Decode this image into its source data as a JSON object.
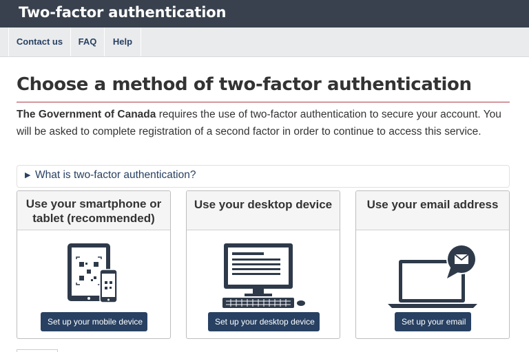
{
  "header": {
    "title": "Two-factor authentication"
  },
  "nav": {
    "items": [
      "Contact us",
      "FAQ",
      "Help"
    ]
  },
  "main": {
    "heading": "Choose a method of two-factor authentication",
    "intro_strong": "The Government of Canada",
    "intro_text": " requires the use of two-factor authentication to secure your account. You will be asked to complete registration of a second factor in order to continue to access this service.",
    "details_summary": "What is two-factor authentication?"
  },
  "cards": [
    {
      "title": "Use your smartphone or tablet (recommended)",
      "button": "Set up your mobile device",
      "icon": "mobile-devices-icon"
    },
    {
      "title": "Use your desktop device",
      "button": "Set up your desktop device",
      "icon": "desktop-computer-icon"
    },
    {
      "title": "Use your email address",
      "button": "Set up your email",
      "icon": "laptop-email-icon"
    }
  ],
  "colors": {
    "topbar": "#38414d",
    "nav": "#eaebed",
    "link": "#284162",
    "button": "#284162",
    "rule": "#af3c43"
  }
}
